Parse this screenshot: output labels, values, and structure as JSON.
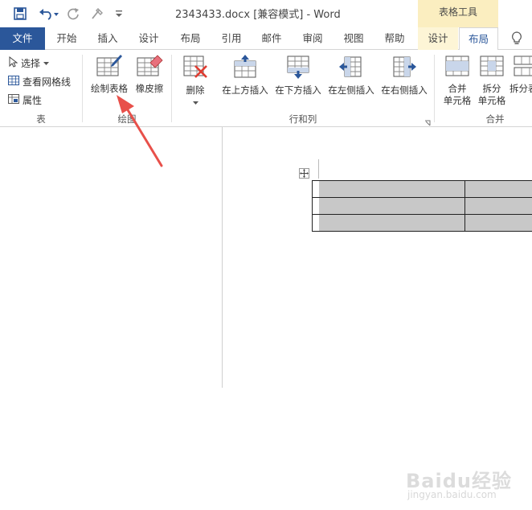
{
  "window": {
    "title": "2343433.docx [兼容模式]  -  Word",
    "context_group_label": "表格工具"
  },
  "qat": {
    "save_icon": "save-icon",
    "undo_icon": "undo-icon",
    "redo_icon": "redo-icon",
    "format_painter_icon": "format-painter-icon",
    "customize_icon": "customize-qat-icon"
  },
  "tabs": {
    "file": "文件",
    "home": "开始",
    "insert": "插入",
    "design": "设计",
    "layout": "布局",
    "references": "引用",
    "mailings": "邮件",
    "review": "审阅",
    "view": "视图",
    "help": "帮助",
    "table_design": "设计",
    "table_layout": "布局",
    "tell_me_icon": "lightbulb-icon"
  },
  "ribbon": {
    "group_table": {
      "label": "表",
      "select": "选择",
      "view_gridlines": "查看网格线",
      "properties": "属性"
    },
    "group_draw": {
      "label": "绘图",
      "draw_table": "绘制表格",
      "eraser": "橡皮擦"
    },
    "group_rows_cols": {
      "label": "行和列",
      "delete": "删除",
      "insert_above": "在上方插入",
      "insert_below": "在下方插入",
      "insert_left": "在左侧插入",
      "insert_right": "在右侧插入"
    },
    "group_merge": {
      "label": "合并",
      "merge_cells_line1": "合并",
      "merge_cells_line2": "单元格",
      "split_cells_line1": "拆分",
      "split_cells_line2": "单元格",
      "split_table": "拆分表"
    }
  },
  "document": {
    "table_rows": 3
  },
  "watermark": {
    "main": "Baidu经验",
    "sub": "jingyan.baidu.com"
  },
  "colors": {
    "accent": "#2b579a",
    "context_tab_bg": "#fbeec0",
    "arrow": "#e8504a",
    "selection_gray": "#c8c8c8"
  }
}
